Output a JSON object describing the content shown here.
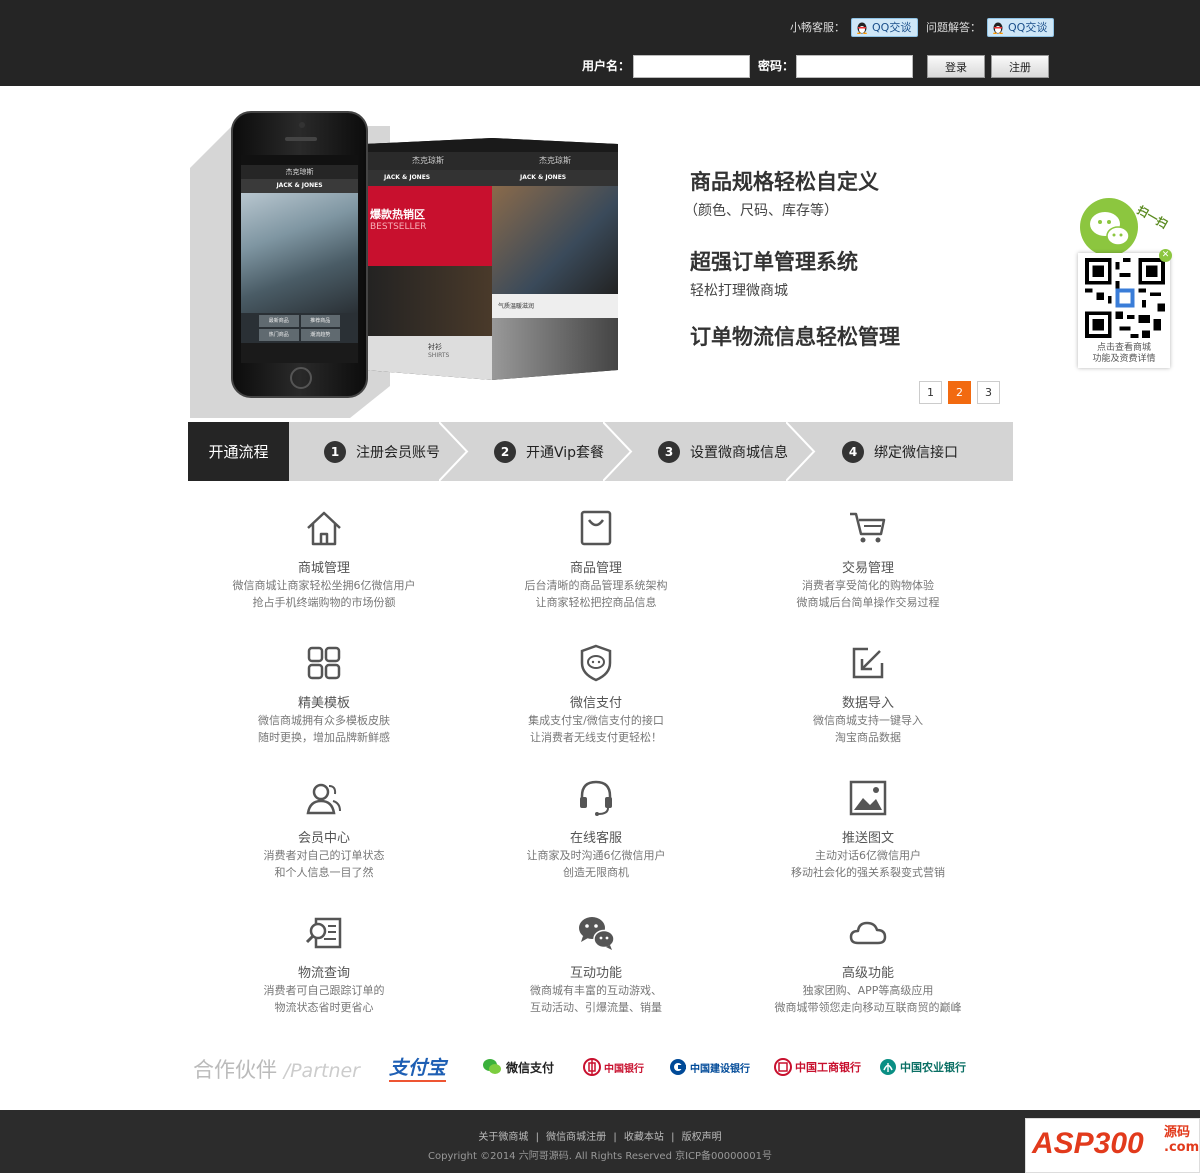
{
  "topbar": {
    "service_label": "小畅客服：",
    "qa_label": "问题解答：",
    "qq_button": "QQ交谈",
    "username_label": "用户名：",
    "password_label": "密码：",
    "login_button": "登录",
    "register_button": "注册"
  },
  "hero": {
    "phone": {
      "title": "杰克琼斯",
      "brand": "JACK & JONES",
      "grid": [
        "最新商品",
        "推荐商品",
        "热门商品",
        "潮流趋势"
      ],
      "cube_left": [
        "爆款热销区",
        "BESTSELLER",
        "衬衫",
        "SHIRTS"
      ],
      "cube_right": [
        "气质温暖滋润"
      ]
    },
    "features": [
      {
        "title": "商品规格轻松自定义",
        "subtitle": "（颜色、尺码、库存等）"
      },
      {
        "title": "超强订单管理系统",
        "subtitle": "轻松打理微商城"
      },
      {
        "title": "订单物流信息轻松管理",
        "subtitle": ""
      }
    ],
    "pages": [
      "1",
      "2",
      "3"
    ],
    "active_page": 2
  },
  "qr": {
    "scan_label": "扫一扫",
    "caption_line1": "点击查看商城",
    "caption_line2": "功能及资费详情"
  },
  "steps": {
    "title": "开通流程",
    "items": [
      {
        "num": "1",
        "label": "注册会员账号"
      },
      {
        "num": "2",
        "label": "开通Vip套餐"
      },
      {
        "num": "3",
        "label": "设置微商城信息"
      },
      {
        "num": "4",
        "label": "绑定微信接口"
      }
    ]
  },
  "features": [
    {
      "icon": "home-icon",
      "name": "商城管理",
      "desc1": "微信商城让商家轻松坐拥6亿微信用户",
      "desc2": "抢占手机终端购物的市场份额"
    },
    {
      "icon": "bag-icon",
      "name": "商品管理",
      "desc1": "后台清晰的商品管理系统架构",
      "desc2": "让商家轻松把控商品信息"
    },
    {
      "icon": "cart-icon",
      "name": "交易管理",
      "desc1": "消费者享受简化的购物体验",
      "desc2": "微商城后台简单操作交易过程"
    },
    {
      "icon": "template-icon",
      "name": "精美模板",
      "desc1": "微信商城拥有众多模板皮肤",
      "desc2": "随时更换，增加品牌新鲜感"
    },
    {
      "icon": "shield-chat-icon",
      "name": "微信支付",
      "desc1": "集成支付宝/微信支付的接口",
      "desc2": "让消费者无线支付更轻松！"
    },
    {
      "icon": "import-icon",
      "name": "数据导入",
      "desc1": "微信商城支持一键导入",
      "desc2": "淘宝商品数据"
    },
    {
      "icon": "members-icon",
      "name": "会员中心",
      "desc1": "消费者对自己的订单状态",
      "desc2": "和个人信息一目了然"
    },
    {
      "icon": "headset-icon",
      "name": "在线客服",
      "desc1": "让商家及时沟通6亿微信用户",
      "desc2": "创造无限商机"
    },
    {
      "icon": "image-icon",
      "name": "推送图文",
      "desc1": "主动对话6亿微信用户",
      "desc2": "移动社会化的强关系裂变式营销"
    },
    {
      "icon": "search-doc-icon",
      "name": "物流查询",
      "desc1": "消费者可自己跟踪订单的",
      "desc2": "物流状态省时更省心"
    },
    {
      "icon": "wechat-icon",
      "name": "互动功能",
      "desc1": "微商城有丰富的互动游戏、",
      "desc2": "互动活动、引爆流量、销量"
    },
    {
      "icon": "cloud-icon",
      "name": "高级功能",
      "desc1": "独家团购、APP等高级应用",
      "desc2": "微商城带领您走向移动互联商贸的巅峰"
    }
  ],
  "partners": {
    "title": "合作伙伴",
    "title_en": "/Partner",
    "logos": [
      "支付宝",
      "微信支付",
      "中国银行",
      "中国建设银行",
      "中国工商银行",
      "中国农业银行"
    ]
  },
  "footer": {
    "links": [
      "关于微商城",
      "微信商城注册",
      "收藏本站",
      "版权声明"
    ],
    "separator": "|",
    "copyright": "Copyright ©2014 六阿哥源码. All Rights Reserved 京ICP备00000001号"
  },
  "watermark": {
    "main": "ASP300",
    "side1": "源码",
    "side2": ".com"
  },
  "colors": {
    "accent": "#f26a10",
    "dark": "#252525",
    "wechat_green": "#8cc63f"
  }
}
